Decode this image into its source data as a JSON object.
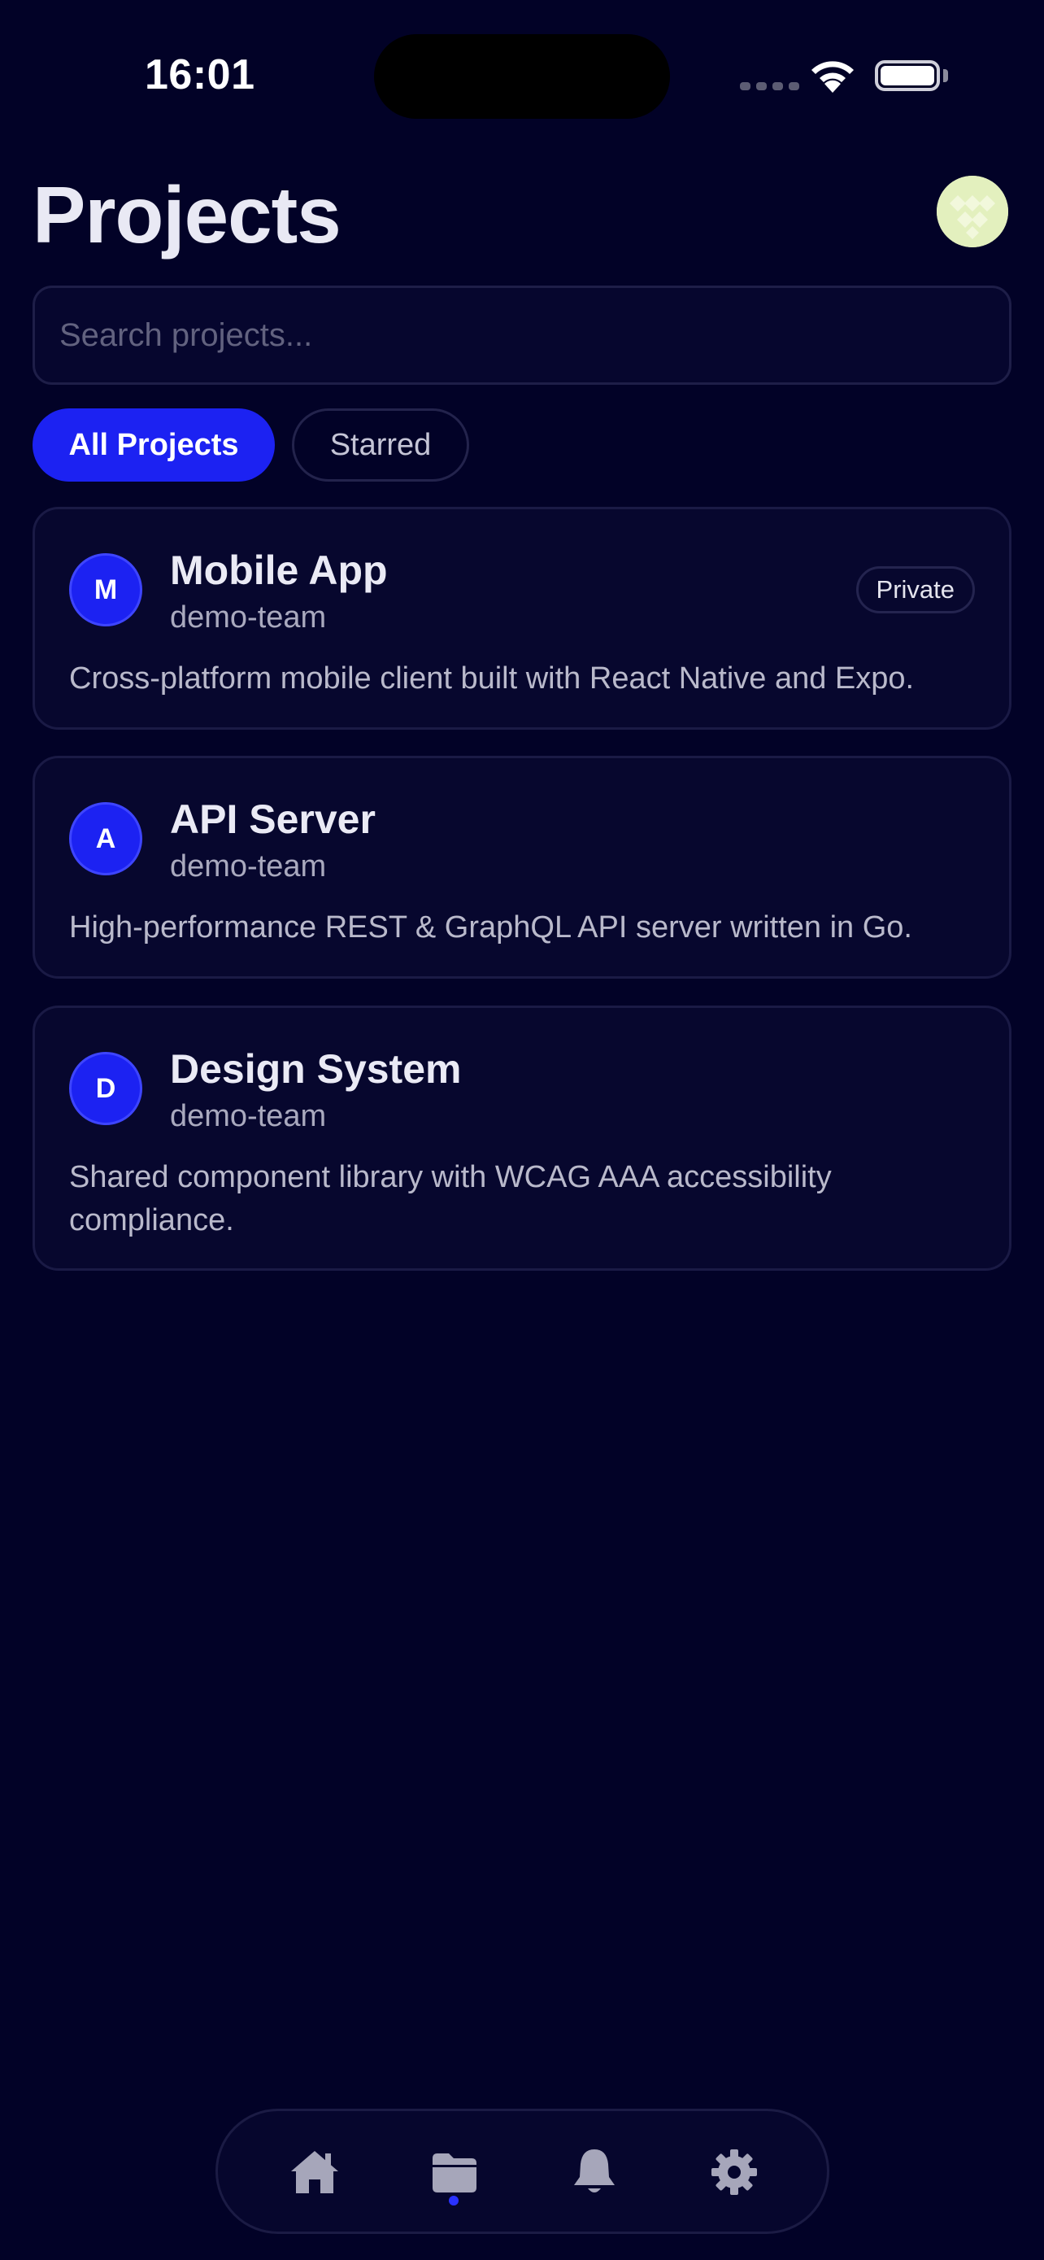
{
  "status_bar": {
    "time": "16:01"
  },
  "header": {
    "title": "Projects",
    "avatar_icon": "user-avatar"
  },
  "search": {
    "placeholder": "Search projects..."
  },
  "filters": [
    {
      "label": "All Projects",
      "active": true
    },
    {
      "label": "Starred",
      "active": false
    }
  ],
  "projects": [
    {
      "initial": "M",
      "name": "Mobile App",
      "owner": "demo-team",
      "badge": "Private",
      "description": "Cross-platform mobile client built with React Native and Expo."
    },
    {
      "initial": "A",
      "name": "API Server",
      "owner": "demo-team",
      "description": "High-performance REST & GraphQL API server written in Go."
    },
    {
      "initial": "D",
      "name": "Design System",
      "owner": "demo-team",
      "description": "Shared component library with WCAG AAA accessibility compliance."
    }
  ],
  "tab_bar": {
    "items": [
      {
        "icon": "home-icon",
        "active": false
      },
      {
        "icon": "folder-icon",
        "active": true
      },
      {
        "icon": "bell-icon",
        "active": false
      },
      {
        "icon": "gear-icon",
        "active": false
      }
    ]
  },
  "colors": {
    "background": "#020227",
    "accent": "#1C22F2",
    "card": "#07072E"
  }
}
